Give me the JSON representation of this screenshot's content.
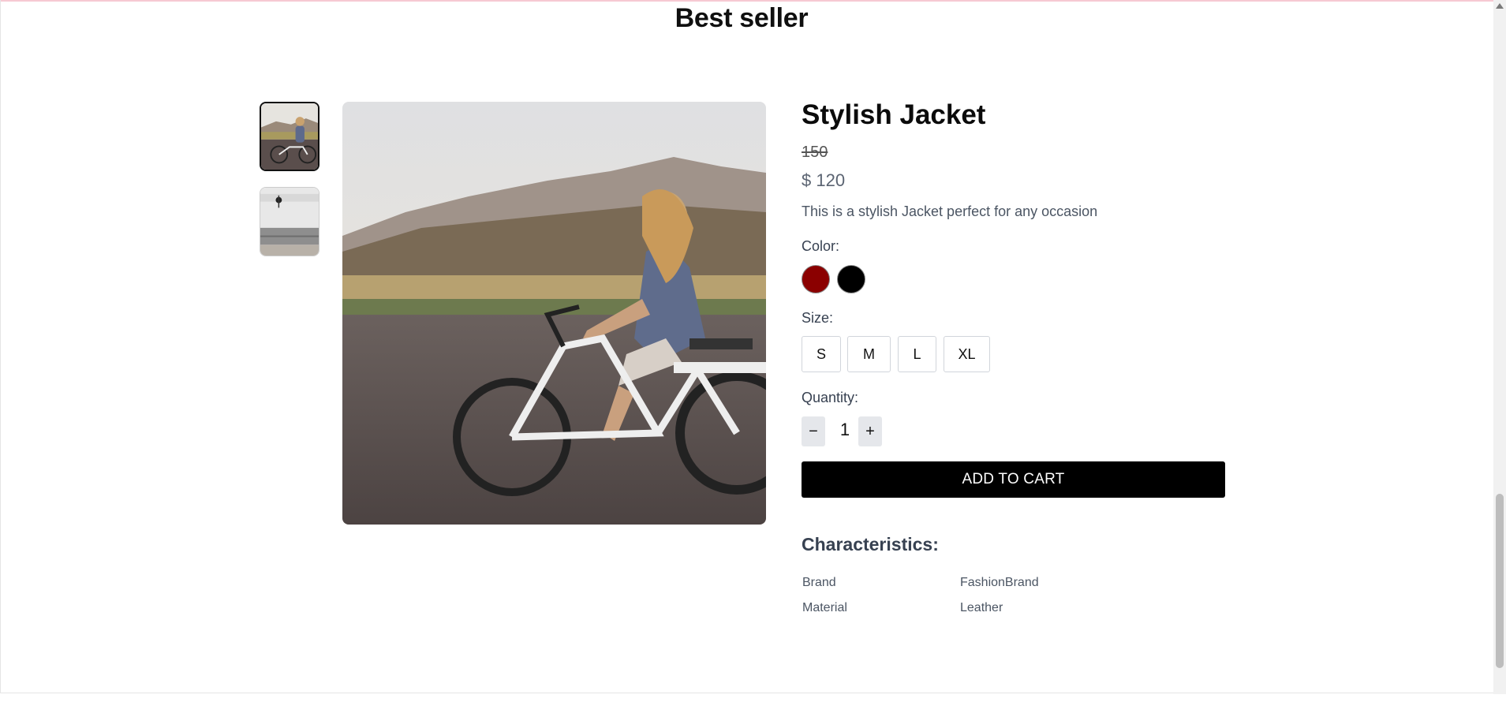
{
  "section": {
    "title": "Best seller"
  },
  "product": {
    "title": "Stylish Jacket",
    "old_price": "150",
    "new_price": "$ 120",
    "description": "This is a stylish Jacket perfect for any occasion",
    "color_label": "Color:",
    "colors": [
      {
        "name": "dark-red",
        "hex": "#8b0000"
      },
      {
        "name": "black",
        "hex": "#000000"
      }
    ],
    "size_label": "Size:",
    "sizes": [
      "S",
      "M",
      "L",
      "XL"
    ],
    "quantity_label": "Quantity:",
    "quantity": "1",
    "decrement_label": "−",
    "increment_label": "+",
    "add_to_cart": "ADD TO CART",
    "characteristics_title": "Characteristics:",
    "characteristics": [
      {
        "key": "Brand",
        "value": "FashionBrand"
      },
      {
        "key": "Material",
        "value": "Leather"
      }
    ]
  }
}
